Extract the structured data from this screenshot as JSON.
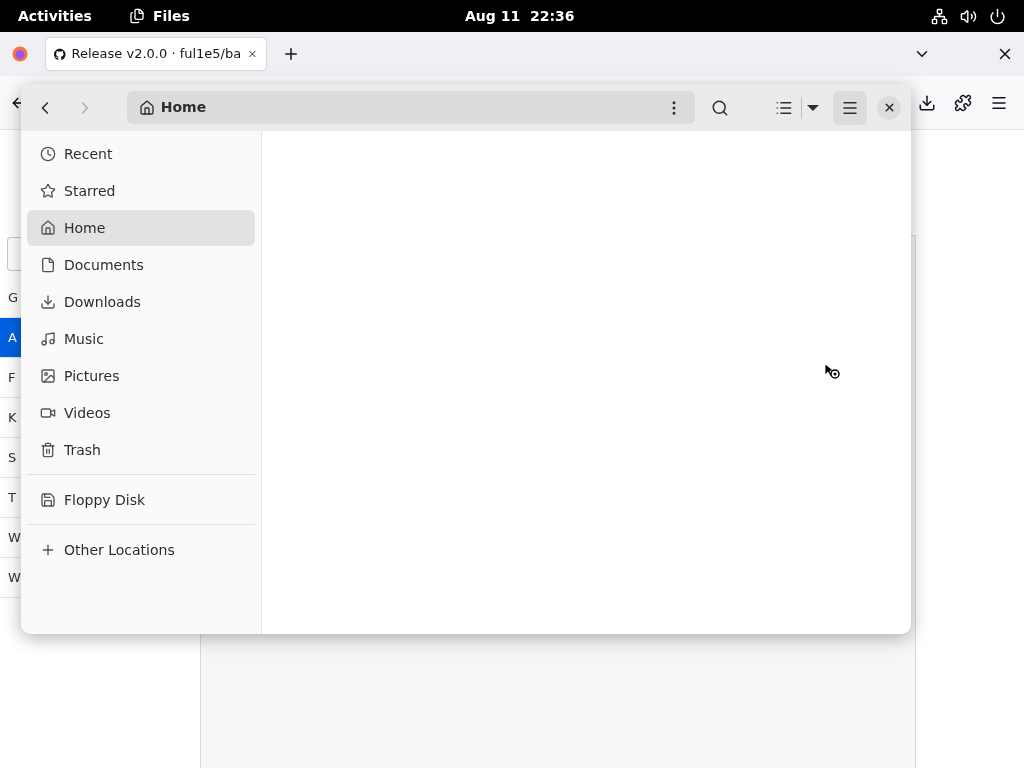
{
  "top_bar": {
    "activities": "Activities",
    "app_name": "Files",
    "clock": "Aug 11  22:36"
  },
  "browser": {
    "tab_title": "Release v2.0.0 · ful1e5/ba",
    "sidebar_items": [
      {
        "label": "G",
        "selected": false
      },
      {
        "label": "A",
        "selected": true
      },
      {
        "label": "F",
        "selected": false
      },
      {
        "label": "K",
        "selected": false
      },
      {
        "label": "S",
        "selected": false
      },
      {
        "label": "T",
        "selected": false
      },
      {
        "label": "W",
        "selected": false
      },
      {
        "label": "W",
        "selected": false
      }
    ]
  },
  "files_window": {
    "path": "Home",
    "sidebar_sections": [
      [
        {
          "label": "Recent",
          "selected": false
        },
        {
          "label": "Starred",
          "selected": false
        },
        {
          "label": "Home",
          "selected": true
        },
        {
          "label": "Documents",
          "selected": false
        },
        {
          "label": "Downloads",
          "selected": false
        },
        {
          "label": "Music",
          "selected": false
        },
        {
          "label": "Pictures",
          "selected": false
        },
        {
          "label": "Videos",
          "selected": false
        },
        {
          "label": "Trash",
          "selected": false
        }
      ],
      [
        {
          "label": "Floppy Disk",
          "selected": false
        }
      ],
      [
        {
          "label": "Other Locations",
          "selected": false
        }
      ]
    ]
  }
}
